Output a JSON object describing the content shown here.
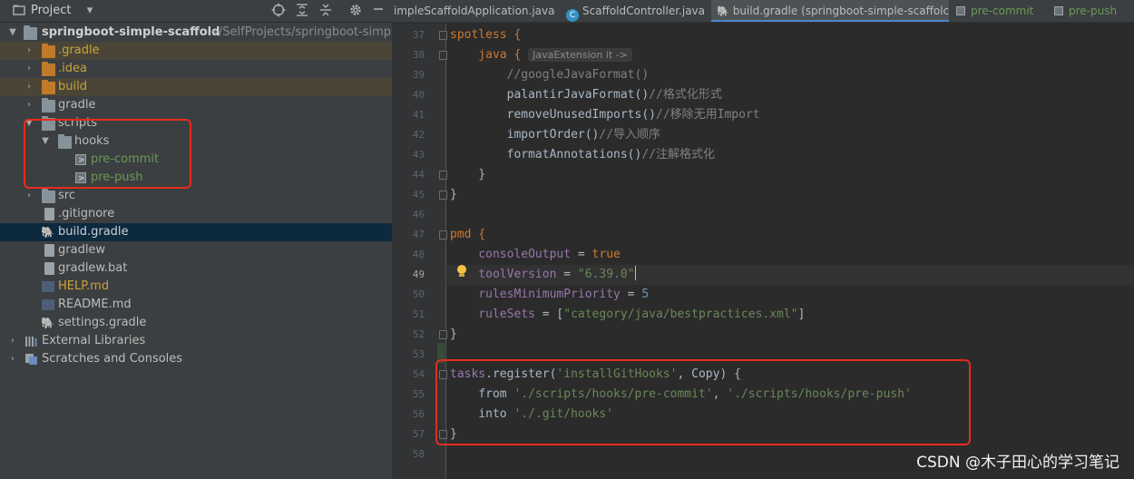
{
  "project_panel": {
    "title": "Project",
    "root_name": "springboot-simple-scaffold",
    "root_path": "~/SelfProjects/springboot-simple",
    "items": [
      {
        "label": ".gradle"
      },
      {
        "label": ".idea"
      },
      {
        "label": "build"
      },
      {
        "label": "gradle"
      },
      {
        "label": "scripts"
      },
      {
        "label": "hooks"
      },
      {
        "label": "pre-commit"
      },
      {
        "label": "pre-push"
      },
      {
        "label": "src"
      },
      {
        "label": ".gitignore"
      },
      {
        "label": "build.gradle"
      },
      {
        "label": "gradlew"
      },
      {
        "label": "gradlew.bat"
      },
      {
        "label": "HELP.md"
      },
      {
        "label": "README.md"
      },
      {
        "label": "settings.gradle"
      },
      {
        "label": "External Libraries"
      },
      {
        "label": "Scratches and Consoles"
      }
    ]
  },
  "tabs": [
    {
      "label": "impleScaffoldApplication.java"
    },
    {
      "label": "ScaffoldController.java"
    },
    {
      "label": "build.gradle (springboot-simple-scaffolc"
    },
    {
      "label": "pre-commit"
    },
    {
      "label": "pre-push"
    }
  ],
  "editor": {
    "current_line": 49,
    "inlay_hint": "JavaExtension it ->",
    "line_numbers": [
      "37",
      "38",
      "39",
      "40",
      "41",
      "42",
      "43",
      "44",
      "45",
      "46",
      "47",
      "48",
      "49",
      "50",
      "51",
      "52",
      "53",
      "54",
      "55",
      "56",
      "57",
      "58"
    ]
  },
  "code": {
    "l37": "spotless {",
    "l38": "java {",
    "l39": "//googleJavaFormat()",
    "l40_fn": "palantirJavaFormat()",
    "l40_c": "//格式化形式",
    "l41_fn": "removeUnusedImports()",
    "l41_c": "//移除无用Import",
    "l42_fn": "importOrder()",
    "l42_c": "//导入顺序",
    "l43_fn": "formatAnnotations()",
    "l43_c": "//注解格式化",
    "l44": "}",
    "l45": "}",
    "l47": "pmd {",
    "l48_p": "consoleOutput",
    "l48_eq": " = ",
    "l48_v": "true",
    "l49_p": "toolVersion",
    "l49_eq": " = ",
    "l49_v": "\"6.39.0\"",
    "l50_p": "rulesMinimumPriority",
    "l50_eq": " = ",
    "l50_v": "5",
    "l51_p": "ruleSets",
    "l51_eq": " = [",
    "l51_v": "\"category/java/bestpractices.xml\"",
    "l51_end": "]",
    "l52": "}",
    "l54_a": "tasks",
    "l54_b": ".register(",
    "l54_c": "'installGitHooks'",
    "l54_d": ", Copy) {",
    "l55_a": "from ",
    "l55_b": "'./scripts/hooks/pre-commit'",
    "l55_c": ", ",
    "l55_d": "'./scripts/hooks/pre-push'",
    "l56_a": "into ",
    "l56_b": "'./.git/hooks'",
    "l57": "}"
  },
  "watermark": "CSDN @木子田心的学习笔记",
  "colors": {
    "keyword": "#cc7832",
    "string": "#6a8759",
    "number": "#6897bb",
    "comment": "#808080",
    "property": "#9876aa",
    "highlight_box": "#e52c1c",
    "selection": "#0d293e"
  }
}
